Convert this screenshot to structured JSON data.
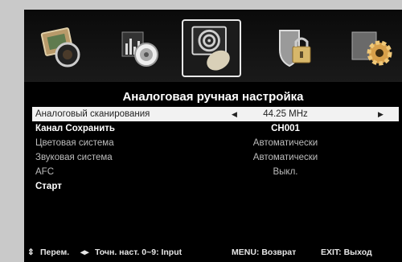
{
  "menu_icons": [
    {
      "name": "picture-icon",
      "selected": false
    },
    {
      "name": "sound-icon",
      "selected": false
    },
    {
      "name": "channel-icon",
      "selected": true
    },
    {
      "name": "lock-icon",
      "selected": false
    },
    {
      "name": "settings-icon",
      "selected": false
    }
  ],
  "panel": {
    "title": "Аналоговая ручная настройка",
    "rows": [
      {
        "label": "Аналоговый сканирования",
        "value": "44.25 MHz",
        "left_arrow": "◀",
        "right_arrow": "▶"
      },
      {
        "label": "Канал Сохранить",
        "value": "CH001"
      },
      {
        "label": "Цветовая система",
        "value": "Автоматически"
      },
      {
        "label": "Звуковая система",
        "value": "Автоматически"
      },
      {
        "label": "AFC",
        "value": "Выкл."
      },
      {
        "label": "Старт",
        "value": ""
      }
    ]
  },
  "footer": {
    "move": "Перем.",
    "fine_tune": "Точн. наст. 0~9: Input",
    "menu_back": "MENU: Возврат",
    "exit": "EXIT: Выход"
  },
  "colors": {
    "highlight_row": "#f2f2f2",
    "background": "#000000"
  }
}
